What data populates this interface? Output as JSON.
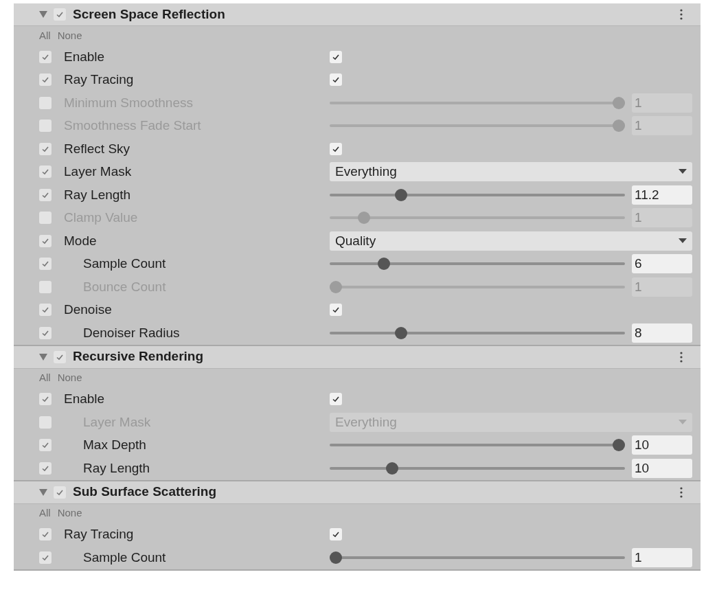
{
  "sections": [
    {
      "title": "Screen Space Reflection",
      "expanded": true,
      "enabled": true,
      "all_label": "All",
      "none_label": "None",
      "rows": [
        {
          "kind": "toggle",
          "label": "Enable",
          "override": true,
          "checked": true
        },
        {
          "kind": "toggle",
          "label": "Ray Tracing",
          "override": true,
          "checked": true
        },
        {
          "kind": "slider",
          "label": "Minimum Smoothness",
          "override": false,
          "level": 1,
          "value": "1"
        },
        {
          "kind": "slider",
          "label": "Smoothness Fade Start",
          "override": false,
          "level": 1,
          "value": "1"
        },
        {
          "kind": "toggle",
          "label": "Reflect Sky",
          "override": true,
          "checked": true
        },
        {
          "kind": "dropdown",
          "label": "Layer Mask",
          "override": true,
          "value": "Everything"
        },
        {
          "kind": "slider",
          "label": "Ray Length",
          "override": true,
          "level": 0.23,
          "value": "11.2"
        },
        {
          "kind": "slider",
          "label": "Clamp Value",
          "override": false,
          "level": 0.1,
          "value": "1"
        },
        {
          "kind": "dropdown",
          "label": "Mode",
          "override": true,
          "value": "Quality",
          "children": [
            {
              "kind": "slider",
              "label": "Sample Count",
              "override": true,
              "level": 0.17,
              "value": "6"
            },
            {
              "kind": "slider",
              "label": "Bounce Count",
              "override": false,
              "level": 0,
              "value": "1"
            }
          ]
        },
        {
          "kind": "toggle",
          "label": "Denoise",
          "override": true,
          "checked": true,
          "children": [
            {
              "kind": "slider",
              "label": "Denoiser Radius",
              "override": true,
              "level": 0.23,
              "value": "8"
            }
          ]
        }
      ]
    },
    {
      "title": "Recursive Rendering",
      "expanded": true,
      "enabled": true,
      "all_label": "All",
      "none_label": "None",
      "rows": [
        {
          "kind": "toggle",
          "label": "Enable",
          "override": true,
          "checked": true,
          "children": [
            {
              "kind": "dropdown",
              "label": "Layer Mask",
              "override": false,
              "value": "Everything"
            },
            {
              "kind": "slider",
              "label": "Max Depth",
              "override": true,
              "level": 1,
              "value": "10"
            },
            {
              "kind": "slider",
              "label": "Ray Length",
              "override": true,
              "level": 0.2,
              "value": "10"
            }
          ]
        }
      ]
    },
    {
      "title": "Sub Surface Scattering",
      "expanded": true,
      "enabled": true,
      "all_label": "All",
      "none_label": "None",
      "rows": [
        {
          "kind": "toggle",
          "label": "Ray Tracing",
          "override": true,
          "checked": true,
          "children": [
            {
              "kind": "slider",
              "label": "Sample Count",
              "override": true,
              "level": 0,
              "value": "1"
            }
          ]
        }
      ]
    }
  ]
}
